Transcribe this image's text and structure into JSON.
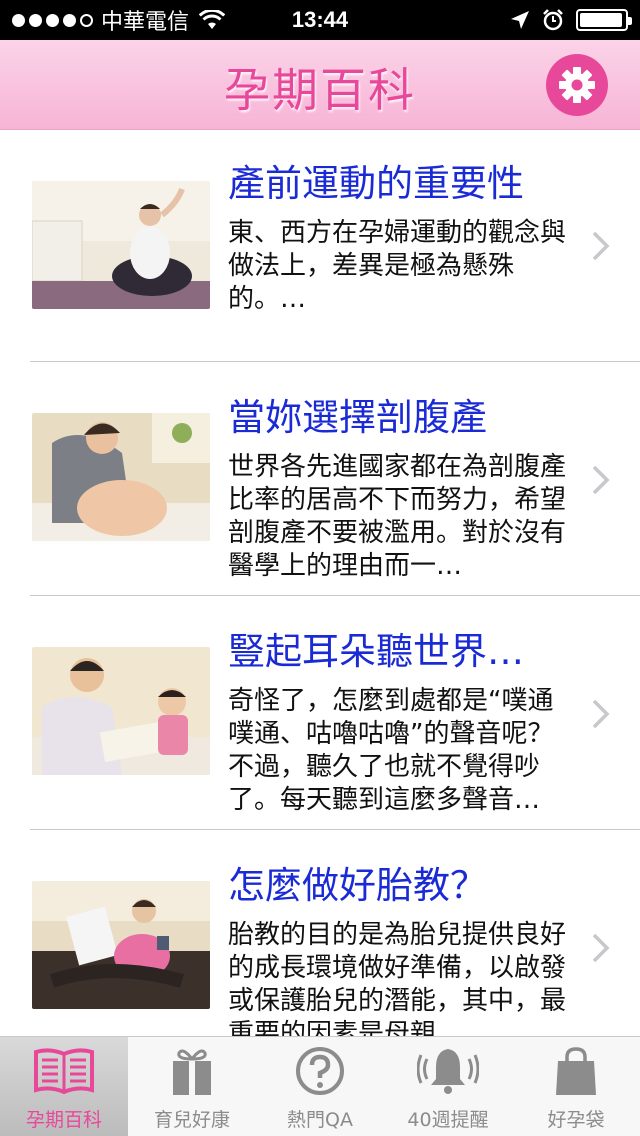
{
  "status_bar": {
    "carrier": "中華電信",
    "time": "13:44",
    "signal_bars_filled": 4,
    "signal_bars_total": 5,
    "battery_level": 0.95,
    "icons": [
      "wifi-icon",
      "location-arrow-icon",
      "alarm-clock-icon",
      "battery-icon"
    ]
  },
  "nav": {
    "title": "孕期百科",
    "settings_icon": "gear-icon"
  },
  "articles": [
    {
      "title": "產前運動的重要性",
      "summary": "東、西方在孕婦運動的觀念與做法上，差異是極為懸殊的。…",
      "image": "pregnant-woman-exercising"
    },
    {
      "title": "當妳選擇剖腹產",
      "summary": "世界各先進國家都在為剖腹產比率的居高不下而努力，希望剖腹產不要被濫用。對於沒有醫學上的理由而一…",
      "image": "pregnant-belly"
    },
    {
      "title": "豎起耳朵聽世界…",
      "summary": "奇怪了，怎麼到處都是“噗通噗通、咕嚕咕嚕”的聲音呢？不過，聽久了也就不覺得吵了。每天聽到這麼多聲音…",
      "image": "mother-reading-with-child"
    },
    {
      "title": "怎麼做好胎教？",
      "summary": "胎教的目的是為胎兒提供良好的成長環境做好準備，以啟發或保護胎兒的潛能，其中，最重要的因素是母親",
      "image": "pregnant-woman-reading-on-sofa"
    }
  ],
  "tabs": [
    {
      "label": "孕期百科",
      "icon": "open-book-icon",
      "active": true
    },
    {
      "label": "育兒好康",
      "icon": "gift-box-icon",
      "active": false
    },
    {
      "label": "熱門QA",
      "icon": "question-mark-icon",
      "active": false
    },
    {
      "label": "40週提醒",
      "icon": "bell-ringing-icon",
      "active": false
    },
    {
      "label": "好孕袋",
      "icon": "shopping-bag-icon",
      "active": false
    }
  ],
  "colors": {
    "accent_pink": "#e8489a",
    "title_blue": "#1a2bd6",
    "nav_gradient_top": "#fbd3e8",
    "nav_gradient_bottom": "#f7b4d6",
    "tab_inactive": "#8c8c8c"
  }
}
